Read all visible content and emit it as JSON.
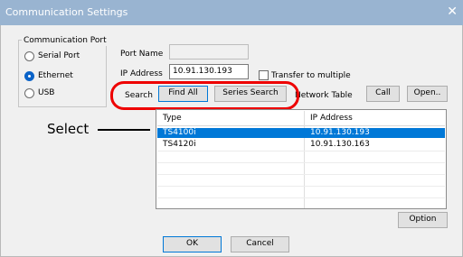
{
  "dialog": {
    "title": "Communication Settings",
    "close_glyph": "✕"
  },
  "comm_port": {
    "title": "Communication Port",
    "options": [
      {
        "label": "Serial Port",
        "checked": false
      },
      {
        "label": "Ethernet",
        "checked": true
      },
      {
        "label": "USB",
        "checked": false
      }
    ]
  },
  "port_name": {
    "label": "Port Name",
    "value": ""
  },
  "ip_address": {
    "label": "IP Address",
    "value": "10.91.130.193"
  },
  "transfer": {
    "label": "Transfer to multiple",
    "checked": false
  },
  "search": {
    "label": "Search",
    "find_all": "Find All",
    "series_search": "Series Search"
  },
  "network_table": {
    "label": "Network Table",
    "call": "Call",
    "open": "Open.."
  },
  "table": {
    "columns": [
      "Type",
      "IP Address"
    ],
    "rows": [
      {
        "type": "TS4100i",
        "ip": "10.91.130.193",
        "selected": true
      },
      {
        "type": "TS4120i",
        "ip": "10.91.130.163",
        "selected": false
      }
    ]
  },
  "buttons": {
    "option": "Option",
    "ok": "OK",
    "cancel": "Cancel"
  },
  "annotation": {
    "select": "Select",
    "highlight_color": "#e00000"
  },
  "colors": {
    "titlebar": "#99b4d1",
    "selection": "#0078d7",
    "dialog_bg": "#f0f0f0"
  }
}
